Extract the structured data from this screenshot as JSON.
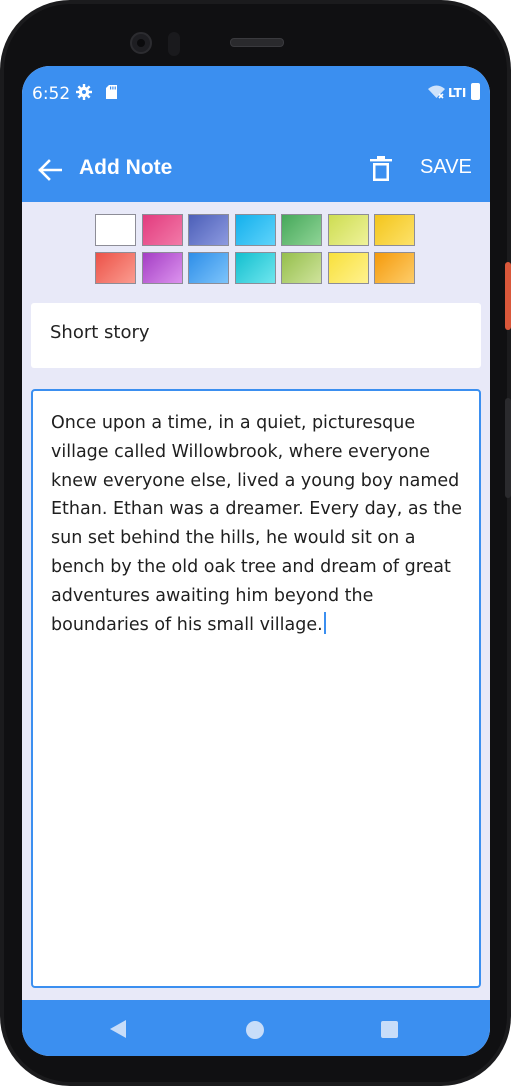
{
  "status_bar": {
    "time": "6:52",
    "network": "LTI",
    "icons": [
      "gear-icon",
      "sd-card-icon",
      "wifi-icon",
      "battery-icon"
    ]
  },
  "app_bar": {
    "title": "Add Note",
    "save_label": "SAVE",
    "icons": [
      "back-arrow-icon",
      "trash-icon"
    ]
  },
  "palette": {
    "swatches": [
      {
        "start": "#ffffff",
        "end": "#ffffff"
      },
      {
        "start": "#e23b7e",
        "end": "#f27aa8"
      },
      {
        "start": "#4c5fb8",
        "end": "#8d9ae0"
      },
      {
        "start": "#14b0ec",
        "end": "#5fd3fb"
      },
      {
        "start": "#46a85a",
        "end": "#8fd496"
      },
      {
        "start": "#cddd52",
        "end": "#eff29a"
      },
      {
        "start": "#f3c51c",
        "end": "#fde26a"
      },
      {
        "start": "#ec5248",
        "end": "#fb9c90"
      },
      {
        "start": "#a43ec4",
        "end": "#dc93ee"
      },
      {
        "start": "#2e8ee8",
        "end": "#7dc4fb"
      },
      {
        "start": "#14bfcf",
        "end": "#6fe6ee"
      },
      {
        "start": "#95bf4c",
        "end": "#cfe39c"
      },
      {
        "start": "#f8e03c",
        "end": "#fff28f"
      },
      {
        "start": "#f59a0c",
        "end": "#fdcd6a"
      }
    ]
  },
  "note": {
    "title": "Short story",
    "body": "Once upon a time, in a quiet, picturesque village called Willowbrook, where everyone knew everyone else, lived a young boy named Ethan. Ethan was a dreamer. Every day, as the sun set behind the hills, he would sit on a bench by the old oak tree and dream of great adventures awaiting him beyond the boundaries of his small village."
  },
  "nav_bar": {
    "icons": [
      "nav-back-icon",
      "nav-home-icon",
      "nav-recents-icon"
    ]
  },
  "colors": {
    "primary": "#3b8ff0",
    "background": "#e8e9f8"
  }
}
